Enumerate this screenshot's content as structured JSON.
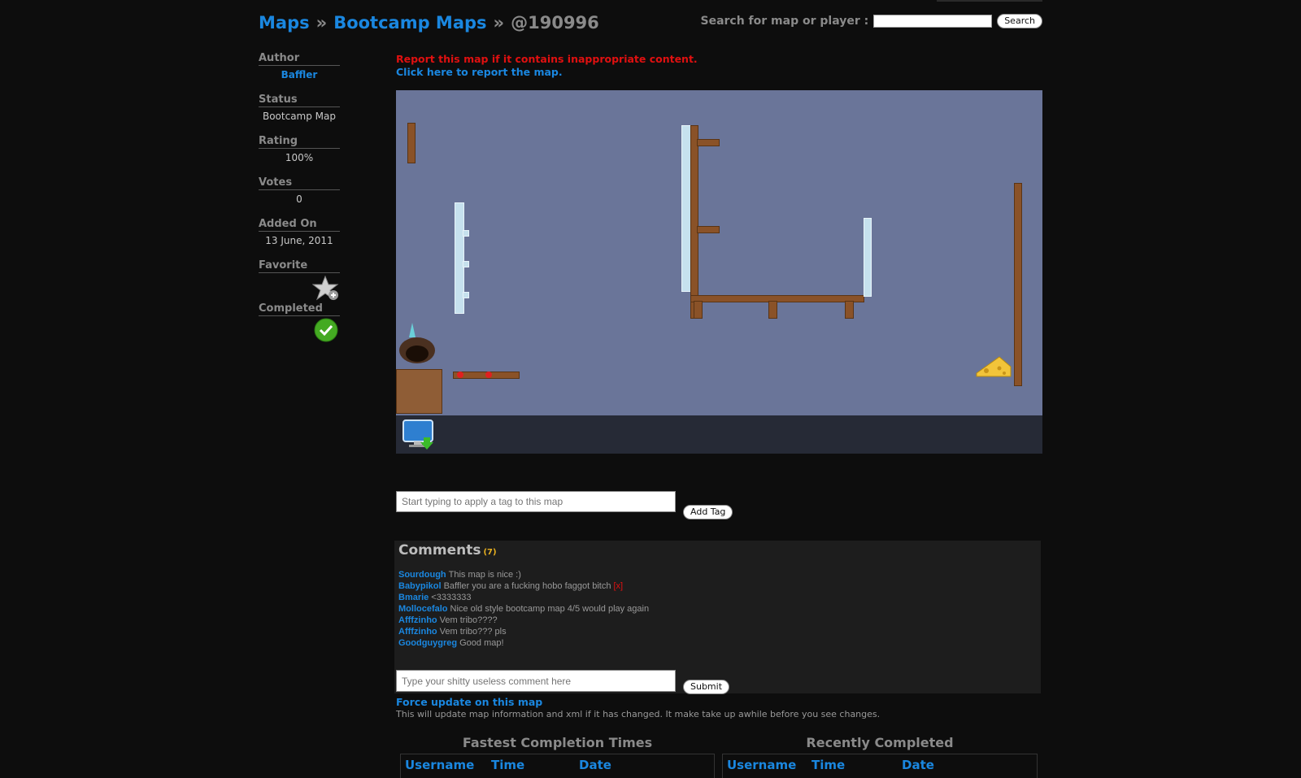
{
  "breadcrumb": {
    "maps": "Maps",
    "sep1": "»",
    "category": "Bootcamp Maps",
    "sep2": "»",
    "current": "@190996"
  },
  "search": {
    "label": "Search for map or player :",
    "button": "Search",
    "value": ""
  },
  "sidebar": {
    "author_label": "Author",
    "author": "Baffler",
    "status_label": "Status",
    "status": "Bootcamp Map",
    "rating_label": "Rating",
    "rating": "100%",
    "votes_label": "Votes",
    "votes": "0",
    "added_label": "Added On",
    "added": "13 June, 2011",
    "favorite_label": "Favorite",
    "completed_label": "Completed"
  },
  "report": {
    "warning": "Report this map if it contains inappropriate content.",
    "link": "Click here to report the map."
  },
  "tag": {
    "placeholder": "Start typing to apply a tag to this map",
    "button": "Add Tag"
  },
  "comments": {
    "title": "Comments",
    "count": "(7)",
    "items": [
      {
        "user": "Sourdough",
        "text": "This map is nice :)",
        "flag": ""
      },
      {
        "user": "Babypikol",
        "text": "Baffler you are a fucking hobo faggot bitch",
        "flag": "[x]"
      },
      {
        "user": "Bmarie",
        "text": "<3333333",
        "flag": ""
      },
      {
        "user": "Mollocefalo",
        "text": "Nice old style bootcamp map 4/5 would play again",
        "flag": ""
      },
      {
        "user": "Afffzinho",
        "text": "Vem tribo????",
        "flag": ""
      },
      {
        "user": "Afffzinho",
        "text": "Vem tribo??? pls",
        "flag": ""
      },
      {
        "user": "Goodguygreg",
        "text": "Good map!",
        "flag": ""
      }
    ],
    "placeholder": "Type your shitty useless comment here",
    "submit": "Submit"
  },
  "force_update": {
    "link": "Force update on this map",
    "description": "This will update map information and xml if it has changed. It make take up awhile before you see changes."
  },
  "tables": {
    "fastest": {
      "title": "Fastest Completion Times",
      "cols": [
        "Username",
        "Time",
        "Date"
      ]
    },
    "recent": {
      "title": "Recently Completed",
      "cols": [
        "Username",
        "Time",
        "Date"
      ]
    }
  },
  "colors": {
    "link": "#1a87e0",
    "warning": "#e01010",
    "map_bg": "#6a7599",
    "background": "#0d0d0d"
  }
}
